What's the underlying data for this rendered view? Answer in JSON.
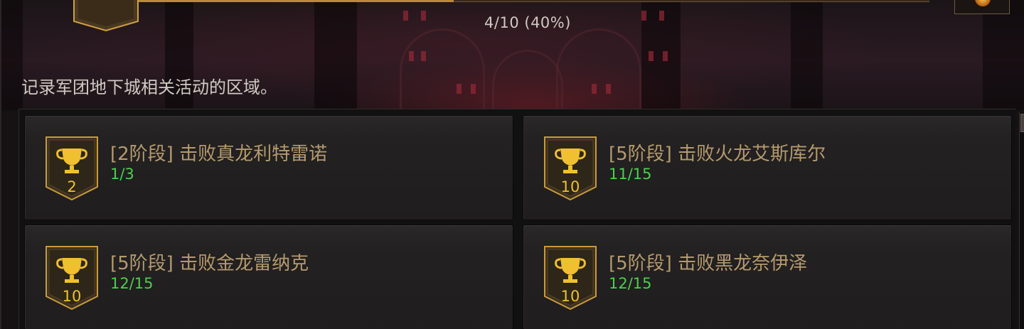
{
  "header": {
    "progress_text": "4/10 (40%)",
    "progress_fraction": 0.4,
    "description": "记录军团地下城相关活动的区域。"
  },
  "achievements": [
    {
      "badge_value": "2",
      "title": "[2阶段] 击败真龙利特雷诺",
      "progress": "1/3",
      "icon": "trophy-icon"
    },
    {
      "badge_value": "10",
      "title": "[5阶段] 击败火龙艾斯库尔",
      "progress": "11/15",
      "icon": "trophy-icon"
    },
    {
      "badge_value": "10",
      "title": "[5阶段] 击败金龙雷纳克",
      "progress": "12/15",
      "icon": "trophy-icon"
    },
    {
      "badge_value": "10",
      "title": "[5阶段] 击败黑龙奈伊泽",
      "progress": "12/15",
      "icon": "trophy-icon"
    }
  ],
  "colors": {
    "title": "#b59a6e",
    "progress": "#4ccf4c",
    "badge_number": "#f0c030",
    "badge_frame": "#d0a040"
  }
}
